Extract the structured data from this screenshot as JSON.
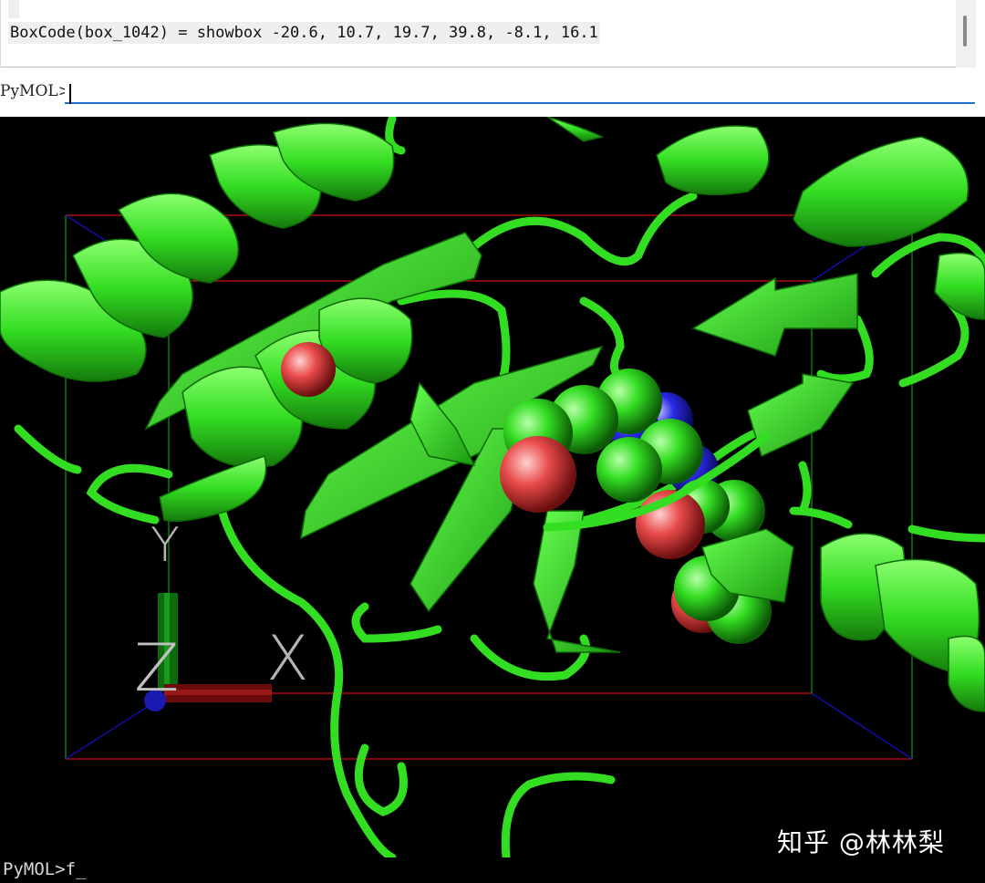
{
  "log": {
    "last_line": "BoxCode(box_1042) = showbox -20.6, 10.7, 19.7, 39.8, -8.1, 16.1"
  },
  "command": {
    "prompt": "PyMOL>",
    "value": ""
  },
  "viewer": {
    "background": "#000000",
    "cartoon_color": "#33dd22",
    "ligand_colors": {
      "carbon": "#33dd22",
      "oxygen": "#e84a4a",
      "nitrogen": "#2a2ae8"
    },
    "box_colors": {
      "x_edges": "#cc1111",
      "y_edges": "#119911",
      "z_edges": "#1111cc"
    },
    "axes": {
      "x_label": "X",
      "y_label": "Y",
      "z_label": "Z"
    },
    "watermark": "知乎 @林林梨"
  },
  "bottom_prompt": {
    "text": "PyMOL>f_"
  }
}
